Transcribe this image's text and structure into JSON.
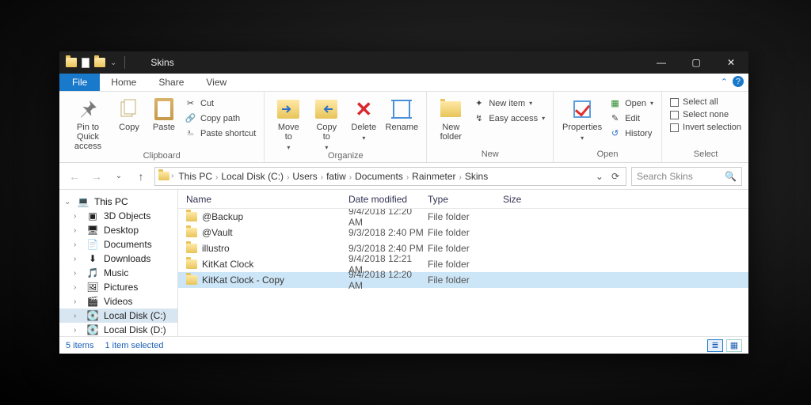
{
  "titlebar": {
    "title": "Skins"
  },
  "window_controls": {
    "min": "—",
    "max": "▢",
    "close": "✕"
  },
  "tabs": {
    "file": "File",
    "home": "Home",
    "share": "Share",
    "view": "View"
  },
  "ribbon": {
    "clipboard": {
      "label": "Clipboard",
      "pin": "Pin to Quick\naccess",
      "copy": "Copy",
      "paste": "Paste",
      "cut": "Cut",
      "copy_path": "Copy path",
      "paste_shortcut": "Paste shortcut"
    },
    "organize": {
      "label": "Organize",
      "move_to": "Move\nto",
      "copy_to": "Copy\nto",
      "delete": "Delete",
      "rename": "Rename"
    },
    "new": {
      "label": "New",
      "new_folder": "New\nfolder",
      "new_item": "New item",
      "easy_access": "Easy access"
    },
    "open": {
      "label": "Open",
      "properties": "Properties",
      "open": "Open",
      "edit": "Edit",
      "history": "History"
    },
    "select": {
      "label": "Select",
      "select_all": "Select all",
      "select_none": "Select none",
      "invert": "Invert selection"
    }
  },
  "nav": {
    "breadcrumbs": [
      "This PC",
      "Local Disk (C:)",
      "Users",
      "fatiw",
      "Documents",
      "Rainmeter",
      "Skins"
    ],
    "search_placeholder": "Search Skins"
  },
  "navpane": {
    "root": "This PC",
    "items": [
      {
        "label": "3D Objects",
        "icon": "cube"
      },
      {
        "label": "Desktop",
        "icon": "desktop"
      },
      {
        "label": "Documents",
        "icon": "doc"
      },
      {
        "label": "Downloads",
        "icon": "download"
      },
      {
        "label": "Music",
        "icon": "music"
      },
      {
        "label": "Pictures",
        "icon": "pic"
      },
      {
        "label": "Videos",
        "icon": "video"
      },
      {
        "label": "Local Disk (C:)",
        "icon": "disk",
        "selected": true
      },
      {
        "label": "Local Disk (D:)",
        "icon": "disk"
      }
    ]
  },
  "columns": {
    "name": "Name",
    "date": "Date modified",
    "type": "Type",
    "size": "Size"
  },
  "files": [
    {
      "name": "@Backup",
      "date": "9/4/2018 12:20 AM",
      "type": "File folder",
      "size": ""
    },
    {
      "name": "@Vault",
      "date": "9/3/2018 2:40 PM",
      "type": "File folder",
      "size": ""
    },
    {
      "name": "illustro",
      "date": "9/3/2018 2:40 PM",
      "type": "File folder",
      "size": ""
    },
    {
      "name": "KitKat Clock",
      "date": "9/4/2018 12:21 AM",
      "type": "File folder",
      "size": ""
    },
    {
      "name": "KitKat Clock - Copy",
      "date": "9/4/2018 12:20 AM",
      "type": "File folder",
      "size": "",
      "selected": true
    }
  ],
  "status": {
    "count": "5 items",
    "selection": "1 item selected"
  }
}
